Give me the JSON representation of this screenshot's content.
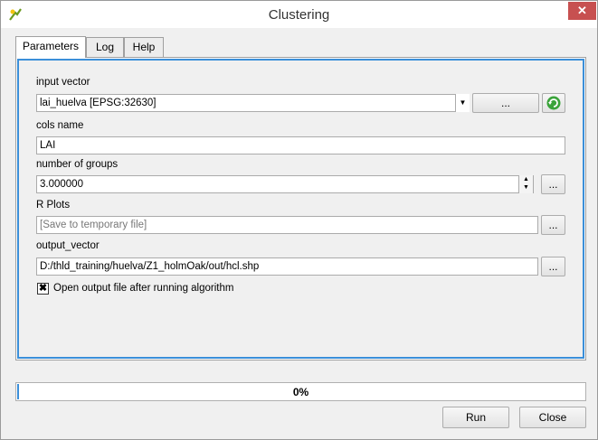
{
  "window": {
    "title": "Clustering",
    "close_label": "✕"
  },
  "tabs": [
    {
      "label": "Parameters"
    },
    {
      "label": "Log"
    },
    {
      "label": "Help"
    }
  ],
  "params": {
    "input_vector": {
      "label": "input vector",
      "value": "lai_huelva [EPSG:32630]",
      "browse_label": "..."
    },
    "cols_name": {
      "label": "cols name",
      "value": "LAI"
    },
    "number_of_groups": {
      "label": "number of groups",
      "value": "3.000000",
      "browse_label": "..."
    },
    "r_plots": {
      "label": "R Plots",
      "placeholder": "[Save to temporary file]",
      "browse_label": "..."
    },
    "output_vector": {
      "label": "output_vector",
      "value": "D:/thld_training/huelva/Z1_holmOak/out/hcl.shp",
      "browse_label": "..."
    },
    "open_output": {
      "label": "Open output file after running algorithm",
      "checked": true,
      "mark": "✖"
    }
  },
  "progress": {
    "text": "0%",
    "value": 0
  },
  "buttons": {
    "run": "Run",
    "close": "Close"
  }
}
